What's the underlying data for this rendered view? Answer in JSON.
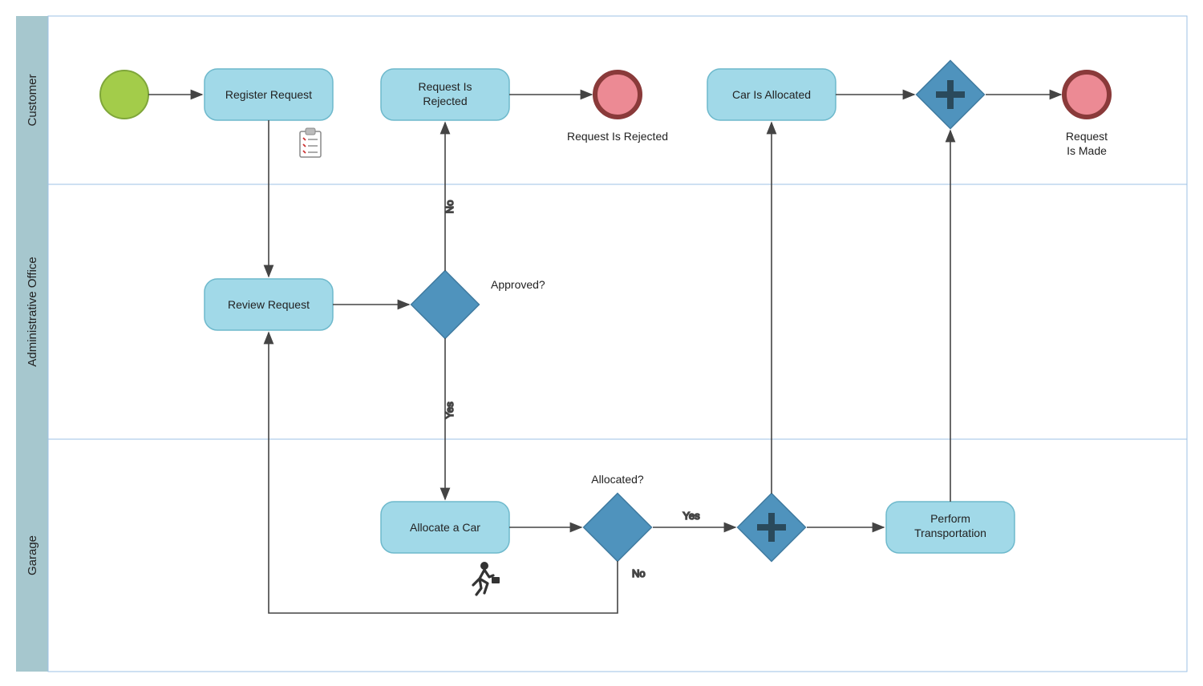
{
  "lanes": {
    "customer": "Customer",
    "admin": "Administrative Office",
    "garage": "Garage"
  },
  "tasks": {
    "register_request": "Register Request",
    "request_rejected": "Request Is\nRejected",
    "car_allocated": "Car Is Allocated",
    "review_request": "Review Request",
    "allocate_car": "Allocate a Car",
    "perform_transport": "Perform\nTransportation"
  },
  "gateways": {
    "approved": "Approved?",
    "allocated": "Allocated?"
  },
  "end_events": {
    "rejected": "Request Is Rejected",
    "made": "Request\nIs Made"
  },
  "edge_labels": {
    "no_up": "No",
    "yes_down": "Yes",
    "yes_right": "Yes",
    "no_down": "No"
  },
  "icons": {
    "clipboard": "clipboard-icon",
    "running_person": "running-person-icon",
    "plus": "plus-icon"
  },
  "colors": {
    "lane_header": "#a6c7ce",
    "lane_border": "#9cc2e6",
    "task_fill": "#a1d9e8",
    "task_stroke": "#6eb9cc",
    "gateway_fill": "#4f93bd",
    "gateway_stroke": "#3f7aa0",
    "start_fill": "#a3cc4a",
    "start_stroke": "#7fa63a",
    "end_fill": "#ec8a94",
    "end_stroke": "#8a3a3a",
    "arrow": "#444"
  }
}
